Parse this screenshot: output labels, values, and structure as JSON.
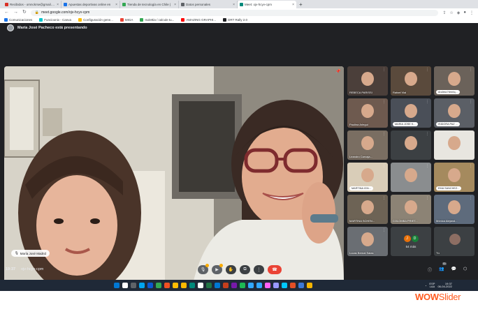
{
  "browser": {
    "tabs": [
      {
        "label": "Recibidos - omnckrse@gmail.com",
        "favicon_color": "#d93025",
        "active": false
      },
      {
        "label": "Apuestas deportivas online en",
        "favicon_color": "#1a73e8",
        "active": false
      },
      {
        "label": "Tienda de tecnología en Chile |",
        "favicon_color": "#34a853",
        "active": false
      },
      {
        "label": "Datos personales",
        "favicon_color": "#5f6368",
        "active": false
      },
      {
        "label": "Meet: ojv-hcyv-cpm",
        "favicon_color": "#00897b",
        "active": true
      }
    ],
    "new_tab": "+",
    "close_glyph": "×",
    "address": "meet.google.com/ojv-hcyv-cpm",
    "bookmarks": [
      {
        "label": "Comunicaciones",
        "color": "#1a73e8"
      },
      {
        "label": "Funcioonix - Canva",
        "color": "#00c4cc"
      },
      {
        "label": "Configuración gene...",
        "color": "#fbbc04"
      },
      {
        "label": "MIGA",
        "color": "#ea4335"
      },
      {
        "label": "Isolettia / calcule tu...",
        "color": "#34a853"
      },
      {
        "label": "AMAZING GRAPHI...",
        "color": "#ff0000"
      },
      {
        "label": "DRT Rally 2.0",
        "color": "#202124"
      }
    ]
  },
  "meet": {
    "presenting_banner": "María José Pacheco está presentando",
    "main_participant": "María José Madrid",
    "tiles": [
      {
        "name": "REBECA PARISSI",
        "bg": "#4b3f3a"
      },
      {
        "name": "Rafael Vial",
        "bg": "#5a4a3c"
      },
      {
        "name": "Andrea Henriq...",
        "bg": "#6b625a",
        "boxed": true
      },
      {
        "name": "Paulina Arlegui",
        "bg": "#6e5a4f"
      },
      {
        "name": "MARIA JOSE K...",
        "bg": "#4a4f58",
        "boxed": true
      },
      {
        "name": "ISIDORA PAZ ...",
        "bg": "#5b5f66",
        "boxed": true
      },
      {
        "name": "Leandro Carvaja...",
        "bg": "#7a6e62"
      },
      {
        "name": "",
        "bg": "#3c4043"
      },
      {
        "name": "",
        "bg": "#e8e6e0"
      },
      {
        "name": "MARTINA IGN...",
        "bg": "#d9cdb8",
        "boxed": true
      },
      {
        "name": "",
        "bg": "#8a8d8f"
      },
      {
        "name": "EMA SANCHEZ...",
        "bg": "#a58a5e",
        "boxed": true
      },
      {
        "name": "MARTINA SCHEN...",
        "bg": "#6d6355"
      },
      {
        "name": "COLOMBA PRIET...",
        "bg": "#8c8375"
      },
      {
        "name": "Mónica Alejand...",
        "bg": "#5e6b7c"
      },
      {
        "name": "Lucas Bernal Salas",
        "bg": "#6a6e73"
      }
    ],
    "more": {
      "count_label": "54 más",
      "avatars": [
        {
          "letter": "J",
          "color": "#e8710a"
        },
        {
          "letter": "D",
          "color": "#188038"
        }
      ]
    },
    "self_label": "Tú",
    "clock": "19:37",
    "meeting_code": "ojv-hcyv-cpm",
    "people_count": "70",
    "control_icons": [
      "mic-off",
      "camera-off",
      "raise-hand",
      "present",
      "more"
    ]
  },
  "taskbar": {
    "app_colors": [
      "#0078d4",
      "#ffffff",
      "#5f6368",
      "#00a4ef",
      "#0b57d0",
      "#34a853",
      "#f25022",
      "#fbbc04",
      "#ffb900",
      "#00897b",
      "#ffffff",
      "#217346",
      "#0078d4",
      "#c43e1c",
      "#7719aa",
      "#1db954",
      "#31a8ff",
      "#31a8ff",
      "#ff61f6",
      "#9999ff",
      "#00c8ff",
      "#e34f26",
      "#3c78d8",
      "#f4b400"
    ],
    "lang": "ESP\nLAA",
    "time": "19:37\n06-04-2022"
  },
  "watermark": {
    "brand": "WOW",
    "suffix": "Slider"
  }
}
